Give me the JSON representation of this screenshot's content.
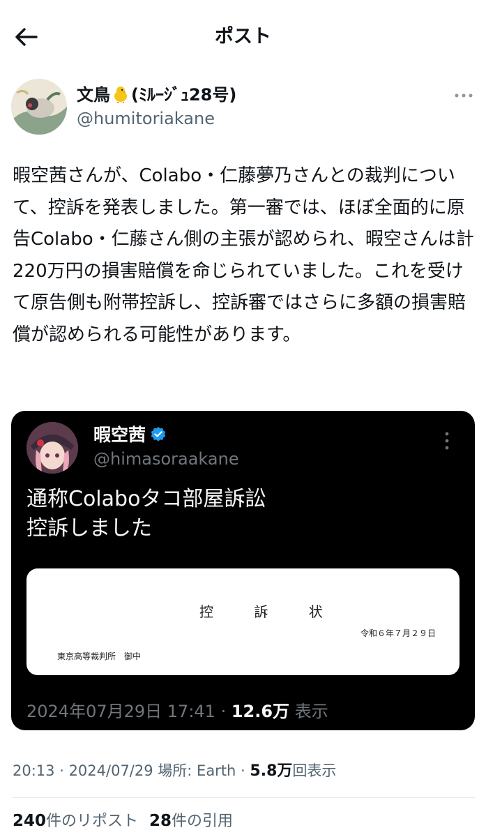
{
  "header": {
    "title": "ポスト"
  },
  "author": {
    "name": "文鳥",
    "name_suffix": "(ﾐﾙｰｼﾞｭ28号)",
    "handle": "@humitoriakane"
  },
  "tweet": {
    "text": "暇空茜さんが、Colabo・仁藤夢乃さんとの裁判について、控訴を発表しました。第一審では、ほぼ全面的に原告Colabo・仁藤さん側の主張が認められ、暇空さんは計220万円の損害賠償を命じられていました。これを受けて原告側も附帯控訴し、控訴審ではさらに多額の損害賠償が認められる可能性があります。"
  },
  "quote": {
    "name": "暇空茜",
    "handle": "@himasoraakane",
    "text_line1": "通称Colaboタコ部屋訴訟",
    "text_line2": "控訴しました",
    "image": {
      "title": "控 訴 状",
      "date": "令和６年７月２９日",
      "court": "東京高等裁判所　御中"
    },
    "timestamp": "2024年07月29日 17:41",
    "sep": " · ",
    "views_count": "12.6万",
    "views_label": " 表示"
  },
  "post_meta": {
    "time": "20:13",
    "sep": " · ",
    "date": "2024/07/29",
    "location": "場所: Earth",
    "views_count": "5.8万",
    "views_label": "回表示"
  },
  "stats": {
    "reposts_count": "240",
    "reposts_label": "件のリポスト",
    "quotes_count": "28",
    "quotes_label": "件の引用"
  },
  "colors": {
    "text": "#0f1419",
    "secondary": "#536471",
    "verified": "#1d9bf0",
    "card_bg": "#000000"
  }
}
